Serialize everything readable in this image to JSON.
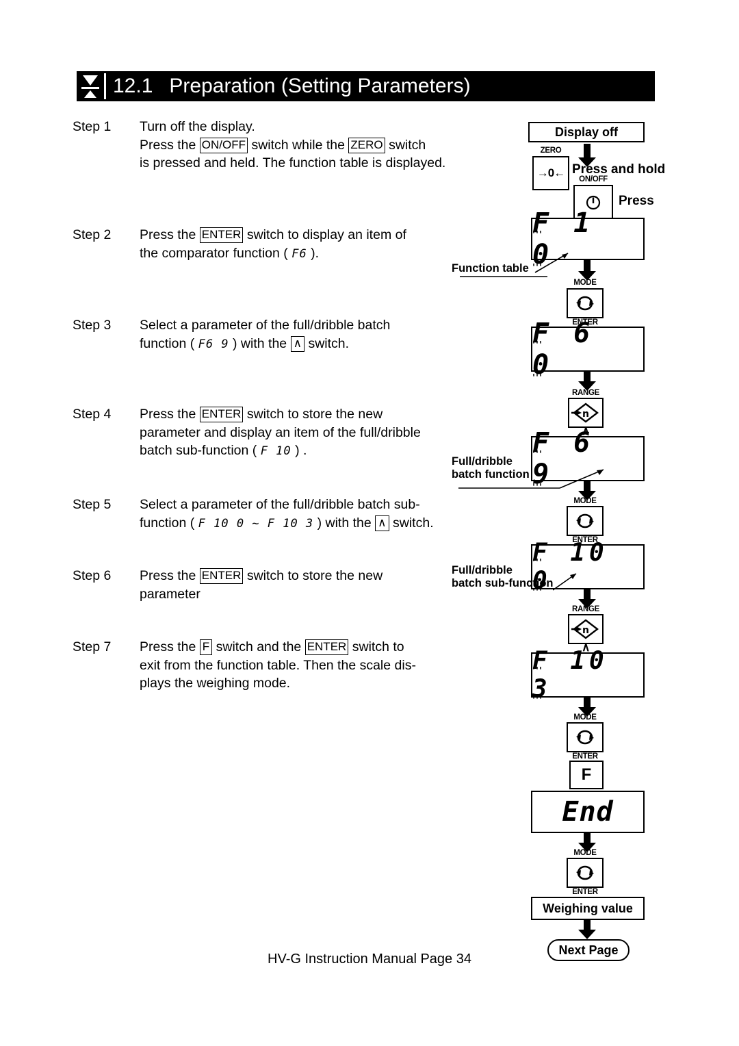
{
  "header": {
    "section_number": "12.1",
    "title": "Preparation (Setting Parameters)",
    "marker_icon": "down-arrow-marker-icon"
  },
  "steps": [
    {
      "label": "Step 1",
      "lines": [
        "Turn off the display.",
        "Press the |ON/OFF| switch while the |ZERO| switch",
        "is pressed and held. The function table is displayed."
      ],
      "line1": "Turn off the display.",
      "line2_a": "Press the",
      "line2_key": "ON/OFF",
      "line2_b": "switch while the",
      "line2_key2": "ZERO",
      "line2_c": "switch",
      "line3": "is pressed and held. The function table is displayed."
    },
    {
      "label": "Step 2",
      "line1_a": "Press the",
      "line1_key": "ENTER",
      "line1_b": "switch to display an item of",
      "line2_a": "the comparator function (",
      "line2_lcd": "F6",
      "line2_b": ")."
    },
    {
      "label": "Step 3",
      "line1": "Select a parameter of the full/dribble batch",
      "line2_a": "function (",
      "line2_lcd": "F6 9",
      "line2_b": ") with the",
      "line2_key": "∧",
      "line2_c": "switch."
    },
    {
      "label": "Step 4",
      "line1_a": "Press the",
      "line1_key": "ENTER",
      "line1_b": "switch to store the new",
      "line2": "parameter and display an item of the full/dribble",
      "line3_a": "batch sub-function (",
      "line3_lcd": "F 10",
      "line3_b": ") ."
    },
    {
      "label": "Step 5",
      "line1": "Select a parameter of the full/dribble batch sub-",
      "line2_a": "function (",
      "line2_lcd": "F 10 0  ~  F 10 3",
      "line2_b": ") with the",
      "line2_key": "∧",
      "line2_c": "switch."
    },
    {
      "label": "Step 6",
      "line1_a": "Press the",
      "line1_key": "ENTER",
      "line1_b": "switch to store the new",
      "line2": "parameter"
    },
    {
      "label": "Step 7",
      "line1_a": "Press the",
      "line1_key": "F",
      "line1_b": "switch and the",
      "line1_key2": "ENTER",
      "line1_c": "switch to",
      "line2": "exit from the function table. Then the scale dis-",
      "line3": "plays the weighing mode."
    }
  ],
  "flowchart": {
    "display_off": "Display off",
    "zero_key": {
      "cap": "ZERO",
      "icon": "zero-target-icon",
      "glyph": "→0←"
    },
    "press_and_hold": "Press and hold",
    "onoff_key": {
      "cap": "ON/OFF",
      "icon": "power-icon"
    },
    "press": "Press",
    "lcd_f1_0": {
      "left": "F 1",
      "right": "0"
    },
    "function_table_label": "Function table",
    "mode_key_1": {
      "cap_top": "MODE",
      "cap_bottom": "ENTER",
      "icon": "circular-arrows-icon"
    },
    "lcd_f6_0": {
      "left": "F 6",
      "right": "0"
    },
    "range_key_1": {
      "cap": "RANGE",
      "icon": "range-diamond-n-icon",
      "caret": "∧"
    },
    "lcd_f6_9": {
      "left": "F 6",
      "right": "9"
    },
    "full_dribble_batch_function_label_l1": "Full/dribble",
    "full_dribble_batch_function_label_l2": "batch function",
    "mode_key_2": {
      "cap_top": "MODE",
      "cap_bottom": "ENTER",
      "icon": "circular-arrows-icon"
    },
    "lcd_f10_0": {
      "left": "F 10",
      "right": "0"
    },
    "full_dribble_batch_subfunction_label_l1": "Full/dribble",
    "full_dribble_batch_subfunction_label_l2": "batch sub-function",
    "range_key_2": {
      "cap": "RANGE",
      "icon": "range-diamond-n-icon",
      "caret": "∧"
    },
    "lcd_f10_3": {
      "left": "F 10",
      "right": "3"
    },
    "mode_key_3": {
      "cap_top": "MODE",
      "cap_bottom": "ENTER",
      "icon": "circular-arrows-icon"
    },
    "f_key": "F",
    "lcd_end": "End",
    "mode_key_4": {
      "cap_top": "MODE",
      "cap_bottom": "ENTER",
      "icon": "circular-arrows-icon"
    },
    "weighing_value": "Weighing value",
    "next_page": "Next Page",
    "blink_top": "'''",
    "blink_bottom": "'''"
  },
  "footer": "HV-G Instruction Manual Page 34"
}
